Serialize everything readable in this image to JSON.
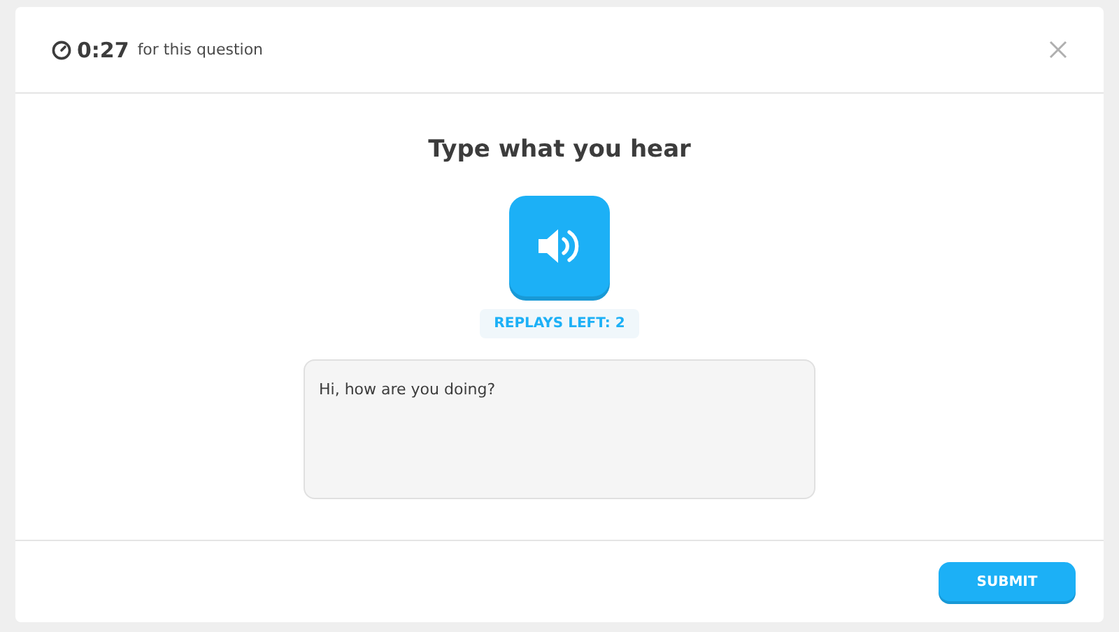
{
  "timer": {
    "time": "0:27",
    "caption": "for this question"
  },
  "prompt": "Type what you hear",
  "replays": "REPLAYS LEFT: 2",
  "answer": {
    "value": "Hi, how are you doing?"
  },
  "submit": "SUBMIT"
}
